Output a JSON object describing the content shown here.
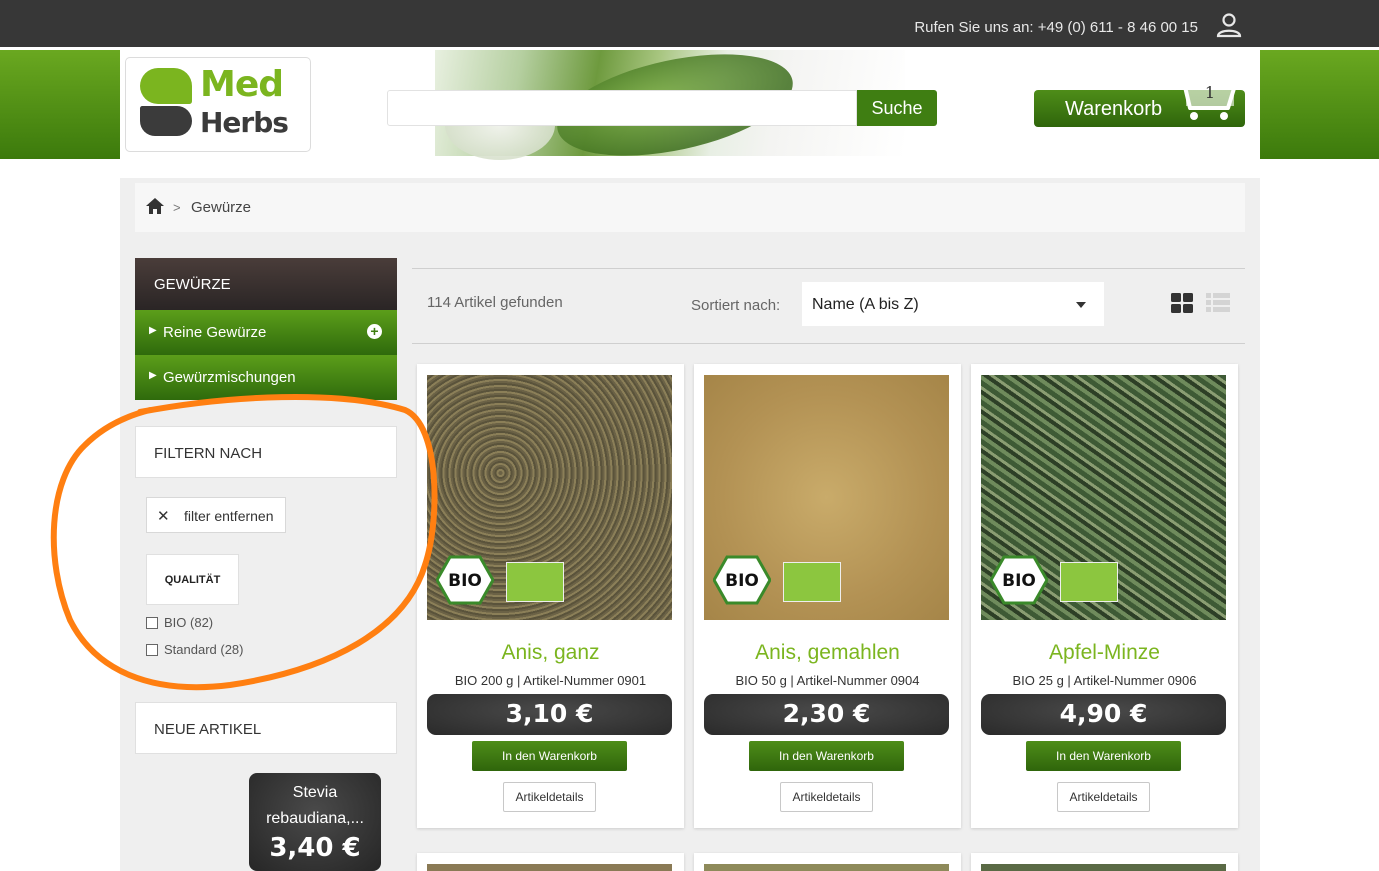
{
  "topbar": {
    "phone": "Rufen Sie uns an: +49 (0) 611 - 8 46 00 15"
  },
  "logo": {
    "line1": "Med",
    "line2": "Herbs"
  },
  "search": {
    "button_label": "Suche",
    "placeholder": ""
  },
  "cart": {
    "label": "Warenkorb",
    "count": "1"
  },
  "breadcrumb": {
    "separator": ">",
    "current": "Gewürze"
  },
  "sidebar": {
    "category_title": "GEWÜRZE",
    "items": [
      {
        "label": "Reine Gewürze"
      },
      {
        "label": "Gewürzmischungen"
      }
    ],
    "filter_title": "FILTERN NACH",
    "remove_filter": "filter entfernen",
    "quality_label": "QUALITÄT",
    "quality_options": [
      {
        "label": "BIO (82)"
      },
      {
        "label": "Standard (28)"
      }
    ],
    "new_title": "NEUE ARTIKEL",
    "new_product": {
      "name_line1": "Stevia",
      "name_line2": "rebaudiana,...",
      "price": "3,40 €"
    }
  },
  "listing": {
    "found": "114 Artikel gefunden",
    "sort_label": "Sortiert nach:",
    "sort_value": "Name (A bis Z)"
  },
  "products": [
    {
      "name": "Anis, ganz",
      "meta": "BIO 200 g | Artikel-Nummer 0901",
      "price": "3,10 €",
      "add_label": "In den Warenkorb",
      "details_label": "Artikeldetails"
    },
    {
      "name": "Anis, gemahlen",
      "meta": "BIO 50 g | Artikel-Nummer 0904",
      "price": "2,30 €",
      "add_label": "In den Warenkorb",
      "details_label": "Artikeldetails"
    },
    {
      "name": "Apfel-Minze",
      "meta": "BIO 25 g | Artikel-Nummer 0906",
      "price": "4,90 €",
      "add_label": "In den Warenkorb",
      "details_label": "Artikeldetails"
    }
  ],
  "badges": {
    "bio": "BIO"
  },
  "colors": {
    "brand_green": "#7bb51f",
    "dark_green": "#3f7e12",
    "annotation_orange": "#ff7f11"
  }
}
